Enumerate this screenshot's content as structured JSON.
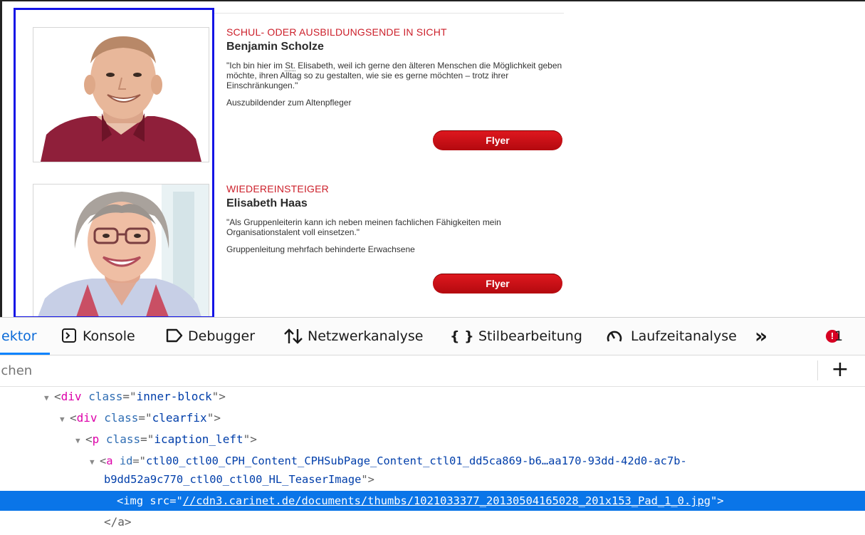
{
  "page": {
    "teasers": [
      {
        "category": "SCHUL- ODER AUSBILDUNGSENDE IN SICHT",
        "name": "Benjamin Scholze",
        "quote_pre": "\"Ich bin hier im ",
        "quote_abbr": "St.",
        "quote_post": " Elisabeth, weil ich gerne den älteren Menschen die Möglichkeit geben möchte, ihren Alltag so zu gestalten, wie sie es gerne möchten – trotz ihrer Einschränkungen.\"",
        "role": "Auszubildender zum Altenpfleger",
        "button": "Flyer"
      },
      {
        "category": "WIEDEREINSTEIGER",
        "name": "Elisabeth Haas",
        "quote": "\"Als Gruppenleiterin kann ich neben meinen fachlichen Fähigkeiten mein Organisationstalent voll einsetzen.\"",
        "role": "Gruppenleitung mehrfach behinderte Erwachsene",
        "button": "Flyer"
      }
    ]
  },
  "devtools": {
    "tabs": [
      {
        "label": "ektor",
        "icon": "inspector-icon",
        "active": true
      },
      {
        "label": "Konsole",
        "icon": "console-icon"
      },
      {
        "label": "Debugger",
        "icon": "debugger-icon"
      },
      {
        "label": "Netzwerkanalyse",
        "icon": "network-icon"
      },
      {
        "label": "Stilbearbeitung",
        "icon": "style-editor-icon"
      },
      {
        "label": "Laufzeitanalyse",
        "icon": "performance-icon"
      }
    ],
    "overflow_label": "»",
    "error_count": "1",
    "search_placeholder": "uchen",
    "add_label": "+",
    "colors": {
      "selection": "#0a75e8",
      "error": "#d70022",
      "accent": "#cc1f2a",
      "highlight_box": "#1515e6"
    },
    "tree": {
      "r1": {
        "tag": "div",
        "attr": "class",
        "val": "inner-block"
      },
      "r2": {
        "tag": "div",
        "attr": "class",
        "val": "clearfix"
      },
      "r3": {
        "tag": "p",
        "attr": "class",
        "val": "icaption_left"
      },
      "r4": {
        "tag": "a",
        "attr": "id",
        "val": "ctl00_ctl00_CPH_Content_CPHSubPage_Content_ctl01_dd5ca869-b6…aa170-93dd-42d0-ac7b-"
      },
      "r4b": "b9dd52a9c770_ctl00_ctl00_HL_TeaserImage",
      "r5": {
        "tag": "img",
        "attr": "src",
        "val": "//cdn3.carinet.de/documents/thumbs/1021033377_20130504165028_201x153_Pad_1_0.jpg"
      },
      "r6": "</a>"
    }
  }
}
